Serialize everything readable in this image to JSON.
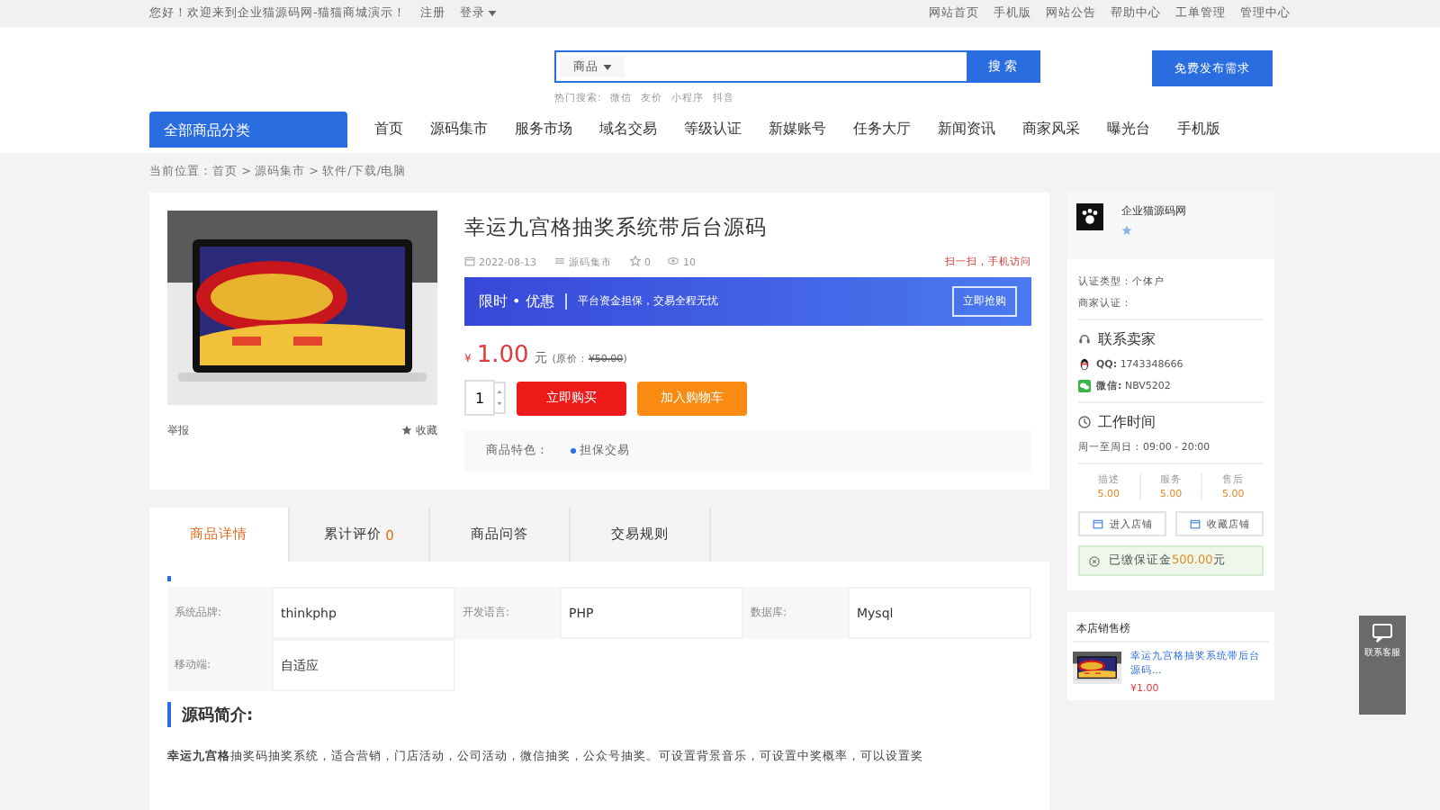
{
  "topbar": {
    "welcome": "您好！欢迎来到企业猫源码网-猫猫商城演示！",
    "register": "注册",
    "login": "登录",
    "links": [
      "网站首页",
      "手机版",
      "网站公告",
      "帮助中心",
      "工单管理"
    ],
    "admin": "管理中心"
  },
  "search": {
    "category": "商品",
    "button": "搜 索",
    "hot_label": "热门搜索:",
    "hot": [
      "微信",
      "友价",
      "小程序",
      "抖音"
    ]
  },
  "publish_button": "免费发布需求",
  "nav": {
    "all": "全部商品分类",
    "items": [
      {
        "label": "首页",
        "selected": false
      },
      {
        "label": "源码集市",
        "selected": false
      },
      {
        "label": "服务市场",
        "selected": false
      },
      {
        "label": "域名交易",
        "selected": false
      },
      {
        "label": "等级认证",
        "selected": false
      },
      {
        "label": "新媒账号",
        "selected": false
      },
      {
        "label": "任务大厅",
        "selected": false
      },
      {
        "label": "新闻资讯",
        "selected": false
      },
      {
        "label": "商家风采",
        "selected": false
      },
      {
        "label": "曝光台",
        "selected": false
      },
      {
        "label": "手机版",
        "selected": false
      }
    ]
  },
  "breadcrumb": "当前位置：首页 > 源码集市 > 软件/下载/电脑",
  "product": {
    "title": "幸运九宫格抽奖系统带后台源码",
    "date": "2022-08-13",
    "category": "源码集市",
    "favorites": "0",
    "views": "10",
    "mobile_link": "扫一扫，手机访问",
    "report": "举报",
    "collect": "收藏",
    "promo": {
      "tag": "限时 • 优惠",
      "text": "平台资金担保，交易全程无忧",
      "button": "立即抢购"
    },
    "currency": "¥",
    "price": "1.00",
    "unit": "元",
    "original_price_label": "(原价：",
    "original_price": "¥50.00",
    "original_price_end": ")",
    "quantity": "1",
    "buy": "立即购买",
    "cart": "加入购物车",
    "features_label": "商品特色：",
    "features": [
      "担保交易"
    ]
  },
  "tabs": [
    {
      "label": "商品详情",
      "selected": true
    },
    {
      "label": "累计评价",
      "count": "0",
      "selected": false
    },
    {
      "label": "商品问答",
      "selected": false
    },
    {
      "label": "交易规则",
      "selected": false
    }
  ],
  "specs": [
    {
      "name": "系统品牌:",
      "value": "thinkphp"
    },
    {
      "name": "开发语言:",
      "value": "PHP"
    },
    {
      "name": "数据库:",
      "value": "Mysql"
    },
    {
      "name": "移动端:",
      "value": "自适应"
    }
  ],
  "intro": {
    "heading": "源码简介:",
    "lines": [
      "**幸运九宫格**抽奖码抽奖系统，适合营销，门店活动，公司活动，微信抽奖，公众号抽奖。可设置背景音乐，可设置中奖概率，可以设置奖"
    ]
  },
  "shop": {
    "name": "企业猫源码网",
    "cert_type": "认证类型：个体户",
    "merchant_cert": "商家认证：",
    "contact_title": "联系卖家",
    "qq": "QQ:",
    "qq_value": "1743348666",
    "wechat": "微信:",
    "wechat_value": "NBV5202",
    "hours_title": "工作时间",
    "hours": "周一至周日：09:00 - 20:00",
    "scores": [
      {
        "label": "描述",
        "value": "5.00"
      },
      {
        "label": "服务",
        "value": "5.00"
      },
      {
        "label": "售后",
        "value": "5.00"
      }
    ],
    "enter": "进入店铺",
    "favorite": "收藏店铺",
    "deposit_label": "已缴保证金",
    "deposit": "500.00",
    "deposit_unit": "元"
  },
  "hot_sales": {
    "title": "本店销售榜",
    "items": [
      {
        "title": "幸运九宫格抽奖系统带后台源码...",
        "price": "¥1.00"
      }
    ]
  },
  "service": "联系客服"
}
